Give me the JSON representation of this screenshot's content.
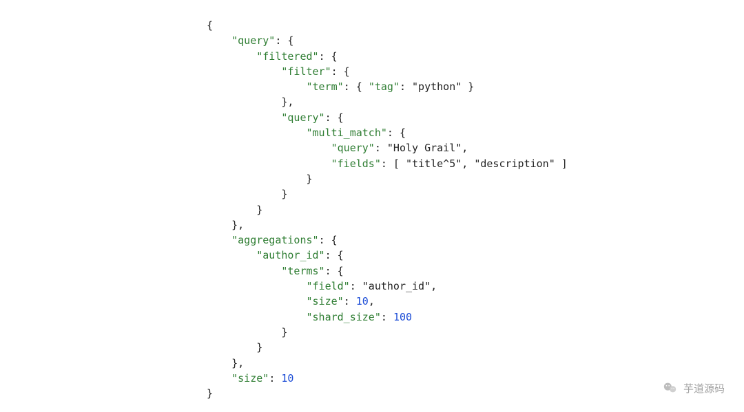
{
  "code": {
    "keys": {
      "query": "\"query\"",
      "filtered": "\"filtered\"",
      "filter": "\"filter\"",
      "term": "\"term\"",
      "tag": "\"tag\"",
      "multi_match": "\"multi_match\"",
      "fields": "\"fields\"",
      "aggregations": "\"aggregations\"",
      "author_id": "\"author_id\"",
      "terms": "\"terms\"",
      "field": "\"field\"",
      "size": "\"size\"",
      "shard_size": "\"shard_size\""
    },
    "strings": {
      "python": "\"python\"",
      "holy_grail": "\"Holy Grail\"",
      "title5": "\"title^5\"",
      "description": "\"description\"",
      "author_id_val": "\"author_id\""
    },
    "numbers": {
      "ten_a": "10",
      "hundred": "100",
      "ten_b": "10"
    }
  },
  "watermark": {
    "text": "芋道源码"
  }
}
